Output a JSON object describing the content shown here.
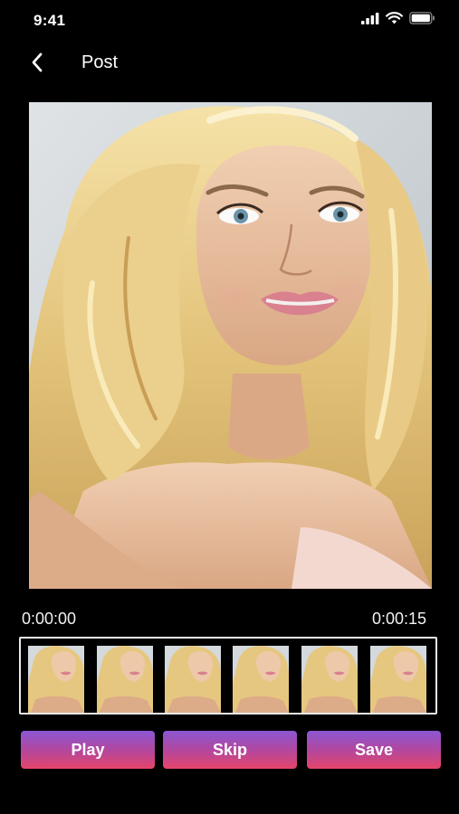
{
  "status_bar": {
    "time": "9:41",
    "icons": [
      "signal-icon",
      "wifi-icon",
      "battery-icon"
    ]
  },
  "header": {
    "back_icon": "chevron-left-icon",
    "title": "Post"
  },
  "preview": {
    "description_icon": "photo-preview"
  },
  "timeline": {
    "start_time": "0:00:00",
    "end_time": "0:00:15",
    "frames": [
      "frame-1",
      "frame-2",
      "frame-3",
      "frame-4",
      "frame-5",
      "frame-6"
    ]
  },
  "actions": {
    "play_label": "Play",
    "skip_label": "Skip",
    "save_label": "Save"
  },
  "colors": {
    "background": "#000000",
    "button_gradient_top": "#8a57d2",
    "button_gradient_bottom": "#e5456a",
    "text": "#ffffff"
  }
}
